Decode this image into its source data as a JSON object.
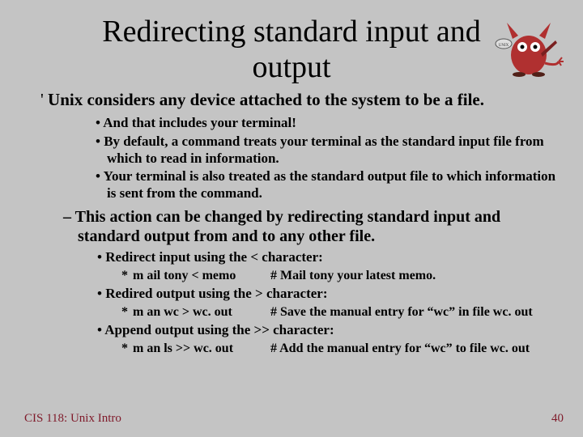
{
  "title": "Redirecting standard input and output",
  "main_point": "Unix considers any device attached to the system to be a file.",
  "sub_points": [
    "And that includes your terminal!",
    "By default, a command treats your terminal as the standard input file from which to read in information.",
    "Your terminal is also treated as the standard output file to which information is sent from the command."
  ],
  "redirect_intro": "This action can be changed by redirecting standard input and standard output from and to any other file.",
  "redirects": [
    {
      "label": "Redirect input using the < character:",
      "cmd": "m ail tony < memo",
      "note": "# Mail tony your latest memo."
    },
    {
      "label": "Redired output using the > character:",
      "cmd": "m an wc > wc. out",
      "note": "# Save the manual entry for “wc” in file wc. out"
    },
    {
      "label": "Append output using the >> character:",
      "cmd": "m an ls >> wc. out",
      "note": "# Add the manual entry for “wc” to file wc. out"
    }
  ],
  "footer": {
    "left": "CIS 118: Unix Intro",
    "page": "40"
  }
}
